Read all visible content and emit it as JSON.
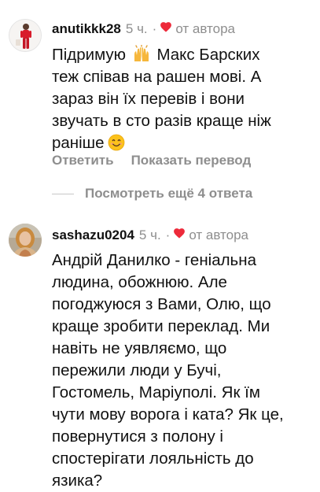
{
  "comments": [
    {
      "username": "anutikkk28",
      "time": "5 ч.",
      "separator": "·",
      "liked_by_author": "от автора",
      "lines": [
        {
          "before": "Підримую ",
          "after": " Макс Барских"
        },
        "теж співав на рашен мові. А",
        "зараз він їх перевів і вони",
        "звучать в сто разів краще ніж",
        "раніше"
      ],
      "actions": {
        "reply": "Ответить",
        "translate": "Показать перевод"
      },
      "more_replies": "Посмотреть ещё 4 ответа"
    },
    {
      "username": "sashazu0204",
      "time": "5 ч.",
      "separator": "·",
      "liked_by_author": "от автора",
      "lines": [
        "Андрій Данилко - геніальна",
        "людина, обожнюю. Але",
        "погоджуюся з Вами, Олю, що",
        "краще зробити переклад. Ми",
        "навіть не уявляємо, що",
        "пережили люди у Бучі,",
        "Гостомель, Маріуполі. Як їм",
        "чути мову ворога і ката? Як це,",
        "повернутися з полону і",
        "спостерігати лояльність до",
        "язика?"
      ]
    }
  ],
  "icons": {
    "heart": "heart-icon",
    "raised_hands": "raising-hands-emoji-icon",
    "smile": "smiling-face-emoji-icon"
  },
  "colors": {
    "muted": "#8e8e8e",
    "heart": "#ed2a3a",
    "text": "#111111"
  }
}
